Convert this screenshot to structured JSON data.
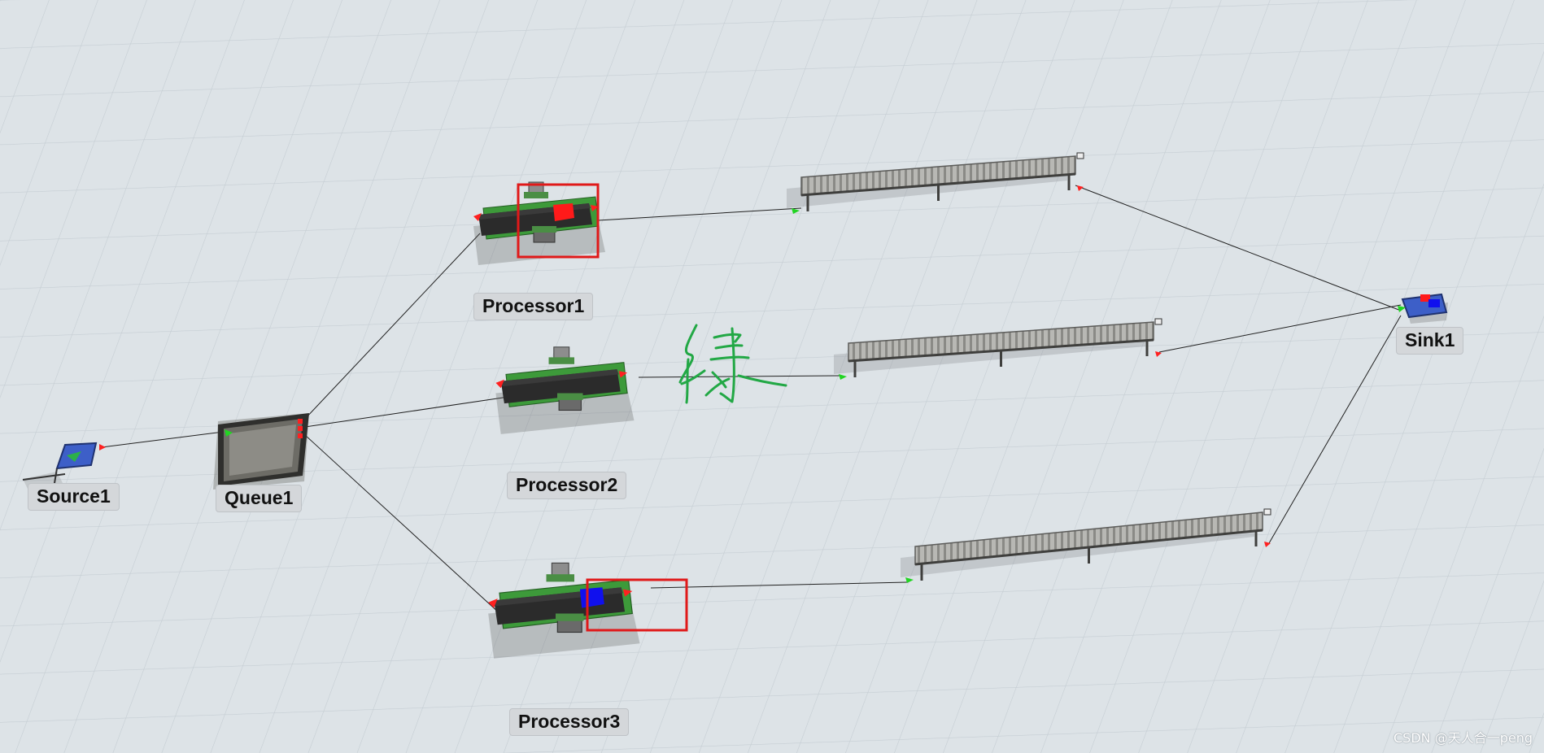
{
  "model_view": {
    "objects": {
      "source": {
        "label": "Source1",
        "icon": "source-icon"
      },
      "queue": {
        "label": "Queue1",
        "icon": "queue-icon"
      },
      "processor1": {
        "label": "Processor1",
        "icon": "processor-icon",
        "item_color": "#ff1a1a",
        "highlighted": true
      },
      "processor2": {
        "label": "Processor2",
        "icon": "processor-icon"
      },
      "processor3": {
        "label": "Processor3",
        "icon": "processor-icon",
        "item_color": "#1010ee",
        "highlighted": true
      },
      "conveyor1": {
        "icon": "conveyor-icon"
      },
      "conveyor2": {
        "icon": "conveyor-icon"
      },
      "conveyor3": {
        "icon": "conveyor-icon"
      },
      "sink": {
        "label": "Sink1",
        "icon": "sink-icon",
        "item_colors": [
          "#ff1a1a",
          "#1010ee"
        ]
      }
    },
    "annotation": {
      "stroke_color": "#22a845",
      "highlight_color": "#e01919"
    },
    "port_colors": {
      "output": "#ff2020",
      "input": "#22d422"
    },
    "watermark": "CSDN @天人合一peng"
  }
}
